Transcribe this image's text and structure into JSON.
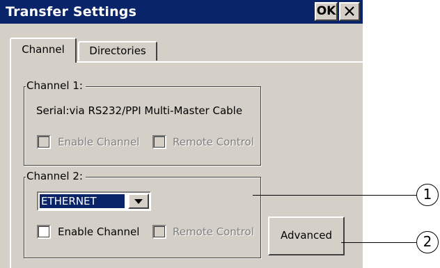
{
  "window": {
    "title": "Transfer Settings",
    "ok_label": "OK",
    "close_icon": "close-icon"
  },
  "tabs": [
    {
      "label": "Channel",
      "active": true
    },
    {
      "label": "Directories",
      "active": false
    }
  ],
  "channel1": {
    "legend": "Channel 1:",
    "description": "Serial:via RS232/PPI Multi-Master Cable",
    "enable_label": "Enable Channel",
    "enable_checked": false,
    "enable_disabled": true,
    "remote_label": "Remote Control",
    "remote_checked": false,
    "remote_disabled": true
  },
  "channel2": {
    "legend": "Channel 2:",
    "combo_value": "ETHERNET",
    "enable_label": "Enable Channel",
    "enable_checked": false,
    "enable_disabled": false,
    "remote_label": "Remote Control",
    "remote_checked": false,
    "remote_disabled": true
  },
  "buttons": {
    "advanced": "Advanced"
  },
  "callouts": [
    "1",
    "2"
  ],
  "colors": {
    "titlebar": "#0a246a",
    "face": "#d4d0c8",
    "selection": "#0a246a"
  }
}
